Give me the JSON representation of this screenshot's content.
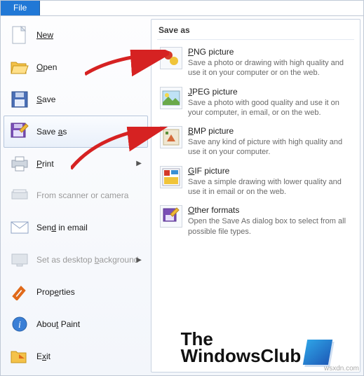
{
  "ribbon": {
    "file_label": "File"
  },
  "left": {
    "new": "New",
    "open": "Open",
    "save": "Save",
    "save_as": "Save as",
    "print": "Print",
    "scanner": "From scanner or camera",
    "email": "Send in email",
    "desktop_bg": "Set as desktop background",
    "properties": "Properties",
    "about": "About Paint",
    "exit": "Exit"
  },
  "panel": {
    "title": "Save as",
    "formats": [
      {
        "title": "PNG picture",
        "desc": "Save a photo or drawing with high quality and use it on your computer or on the web."
      },
      {
        "title": "JPEG picture",
        "desc": "Save a photo with good quality and use it on your computer, in email, or on the web."
      },
      {
        "title": "BMP picture",
        "desc": "Save any kind of picture with high quality and use it on your computer."
      },
      {
        "title": "GIF picture",
        "desc": "Save a simple drawing with lower quality and use it in email or on the web."
      },
      {
        "title": "Other formats",
        "desc": "Open the Save As dialog box to select from all possible file types."
      }
    ]
  },
  "logo": {
    "line1": "The",
    "line2": "WindowsClub"
  },
  "watermark": "wsxdn.com"
}
